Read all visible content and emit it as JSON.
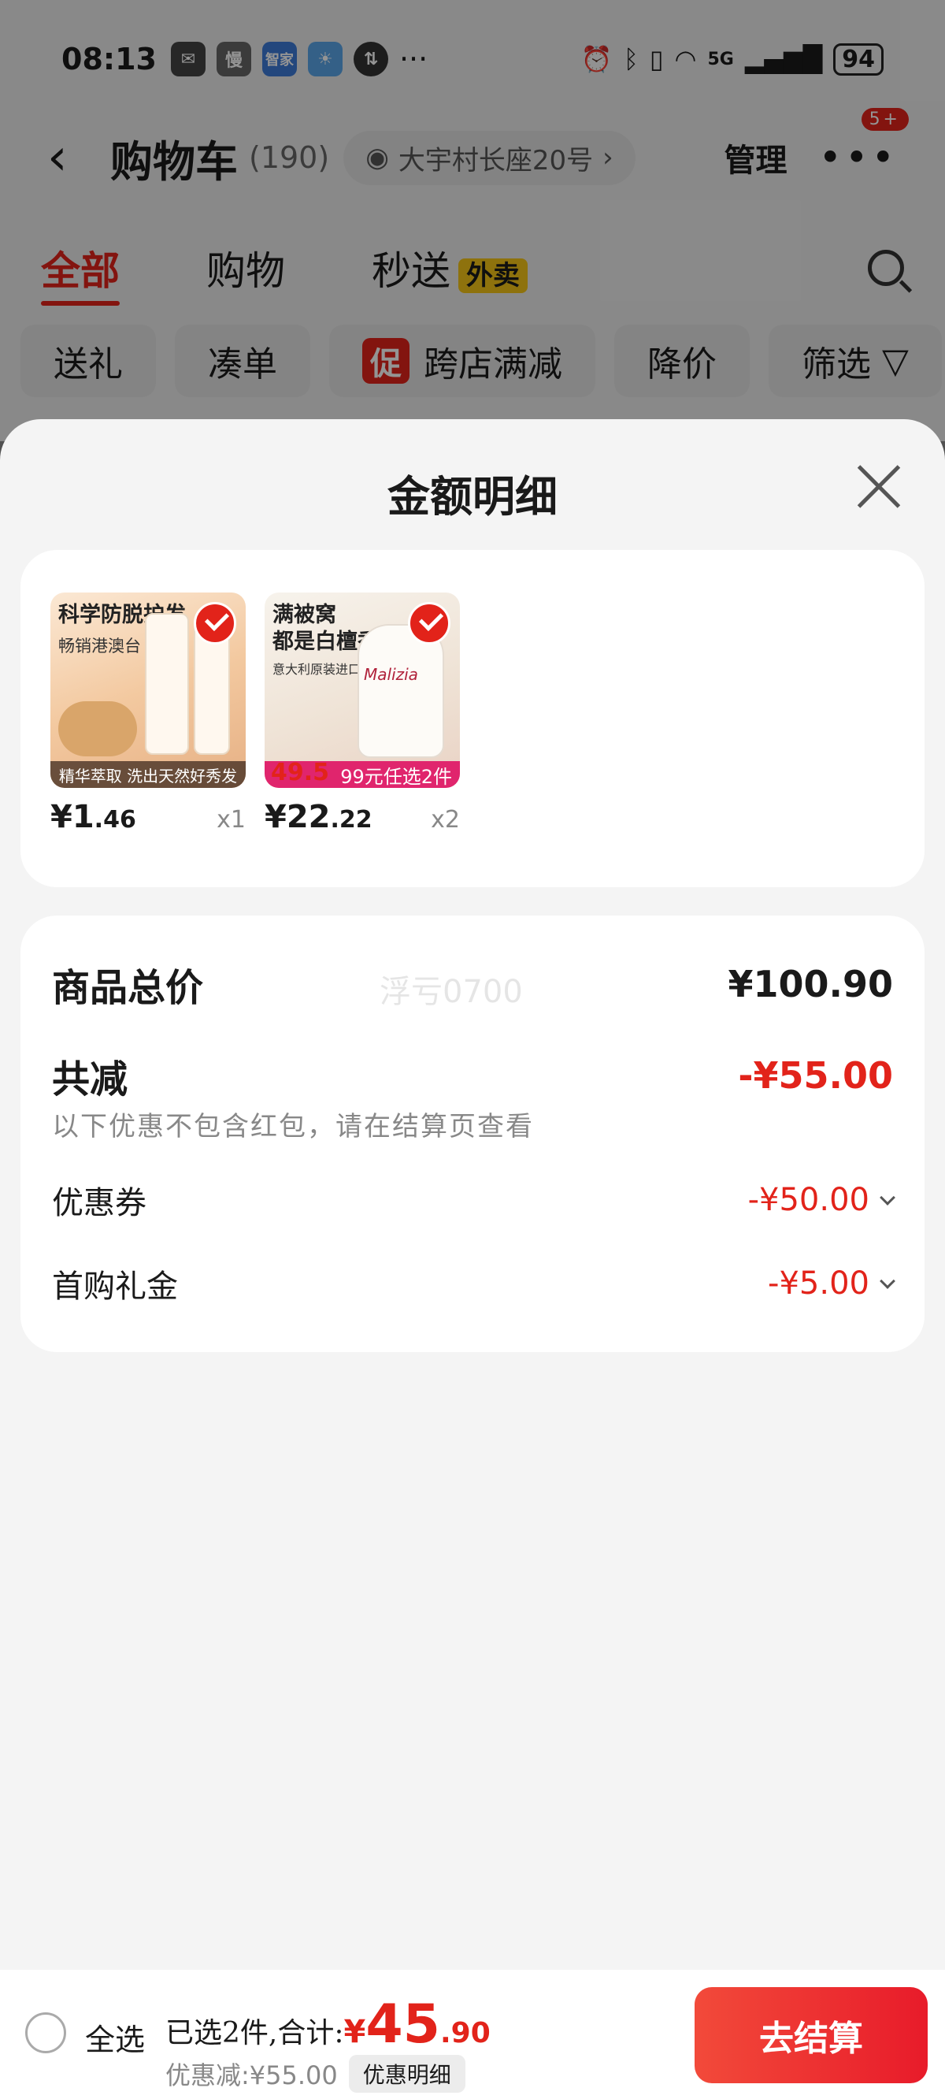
{
  "status_bar": {
    "time": "08:13",
    "app_icon_1": "慢",
    "app_icon_2": "智家",
    "battery": "94",
    "network": "5G"
  },
  "header": {
    "title": "购物车",
    "count": "(190)",
    "address": "大宇村长座20号",
    "manage_label": "管理",
    "more_badge": "5+"
  },
  "tabs": [
    {
      "label": "全部",
      "active": true
    },
    {
      "label": "购物"
    },
    {
      "label": "秒送",
      "badge": "外卖"
    }
  ],
  "filters": {
    "gift": "送礼",
    "combine": "凑单",
    "promo_tag": "促",
    "cross_store": "跨店满减",
    "price_drop": "降价",
    "filter": "筛选"
  },
  "sheet": {
    "title": "金额明细"
  },
  "products": [
    {
      "image_title": "科学防脱护发",
      "image_sub": "畅销港澳台",
      "image_band": "精华萃取 洗出天然好秀发",
      "price_int": "¥1",
      "price_dec": ".46",
      "qty": "x1"
    },
    {
      "image_title": "满被窝\n都是白檀香",
      "image_sub": "意大利原装进口",
      "image_band": "99元任选2件",
      "image_price": "49.5",
      "image_brand": "Malizia",
      "price_int": "¥22",
      "price_dec": ".22",
      "qty": "x2"
    }
  ],
  "summary": {
    "total_label": "商品总价",
    "total_value": "¥100.90",
    "reduce_label": "共减",
    "reduce_value": "-¥55.00",
    "note": "以下优惠不包含红包，请在结算页查看",
    "coupon_label": "优惠券",
    "coupon_value": "-¥50.00",
    "first_buy_label": "首购礼金",
    "first_buy_value": "-¥5.00",
    "watermark": "浮亏0700"
  },
  "bottom_bar": {
    "select_all": "全选",
    "selected_label": "已选2件,合计:",
    "total_yen": "¥",
    "total_int": "45",
    "total_dec": ".90",
    "discount": "优惠减:¥55.00",
    "detail_button": "优惠明细",
    "checkout": "去结算"
  },
  "colors": {
    "accent": "#e2231a",
    "badge_yellow": "#f5c518"
  }
}
